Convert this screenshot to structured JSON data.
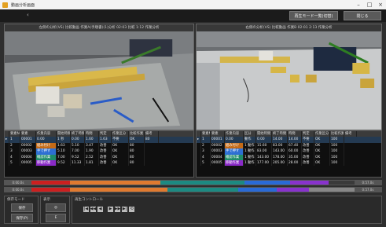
{
  "window": {
    "title": "動画分析画面"
  },
  "toolbar": {
    "left_arrow": "‹",
    "btn_compare": "再生モード一覧(切替)",
    "btn_close": "閉じる"
  },
  "left_video": {
    "caption": "左側の分析(VS) 比較動画 作業A(手順書)(1)分析 02:03 比較 1:12 作業分析"
  },
  "right_video": {
    "caption": "右側の分析(VS) 比較動画 作業B 02:01 2:13 作業分析"
  },
  "left_table": {
    "headers": [
      "",
      "要素No",
      "要素",
      "作業内容",
      "開始時間",
      "終了時間",
      "時間",
      "判定",
      "作業区分",
      "比較作業",
      "備考"
    ],
    "rows": [
      [
        "▸",
        "1",
        "00001",
        "0.00",
        "1 秒",
        "0.00",
        "1.60",
        "1.63",
        "不要",
        "OK",
        "80"
      ],
      [
        "",
        "2",
        "00002",
        "組み付け",
        "1.63",
        "5.10",
        "3.47",
        "改善",
        "OK",
        "80"
      ],
      [
        "",
        "3",
        "00003",
        "手で押す",
        "5.10",
        "7.00",
        "1.90",
        "改善",
        "OK",
        "80"
      ],
      [
        "",
        "4",
        "00004",
        "確認作業",
        "7.00",
        "9.52",
        "2.52",
        "改善",
        "OK",
        "80"
      ],
      [
        "",
        "5",
        "00005",
        "移動作業",
        "9.52",
        "11.33",
        "1.81",
        "改善",
        "OK",
        "80"
      ]
    ],
    "tag_colors": [
      "",
      "#c46a16",
      "#2d6fd3",
      "#1e8c6a",
      "#8a2ac7"
    ]
  },
  "right_table": {
    "headers": [
      "",
      "要素No",
      "要素",
      "作業内容",
      "区分",
      "開始時間",
      "終了時間",
      "時間",
      "判定",
      "作業区分",
      "比較作業",
      "備考"
    ],
    "rows": [
      [
        "▸",
        "1",
        "00001",
        "0.00",
        "動作",
        "0.00",
        "14.00",
        "14.00",
        "不要",
        "OK",
        "100"
      ],
      [
        "",
        "2",
        "00002",
        "組み付け",
        "1 動作",
        "15.60",
        "83.00",
        "67.40",
        "改善",
        "OK",
        "100"
      ],
      [
        "",
        "3",
        "00003",
        "手で押す",
        "1 動作",
        "83.00",
        "143.00",
        "60.00",
        "改善",
        "OK",
        "100"
      ],
      [
        "",
        "4",
        "00004",
        "確認作業",
        "1 動作",
        "143.00",
        "178.00",
        "35.00",
        "改善",
        "OK",
        "100"
      ],
      [
        "",
        "5",
        "00005",
        "移動作業",
        "1 動作",
        "177.00",
        "205.00",
        "28.00",
        "改善",
        "OK",
        "100"
      ]
    ],
    "tag_colors": [
      "",
      "#c46a16",
      "#2d6fd3",
      "#1e8c6a",
      "#8a2ac7"
    ]
  },
  "timeline1": {
    "start": "0:00.0s",
    "end": "0:57.0s",
    "segments": [
      {
        "color": "#cc2020",
        "frac": 0.12
      },
      {
        "color": "#e07a30",
        "frac": 0.28
      },
      {
        "color": "#1d8a82",
        "frac": 0.26
      },
      {
        "color": "#2a6ad6",
        "frac": 0.14
      },
      {
        "color": "#8833cc",
        "frac": 0.12
      },
      {
        "color": "#3a3a3a",
        "frac": 0.08
      }
    ]
  },
  "timeline2": {
    "start": "0:00.0s",
    "end": "0:57.0s",
    "segments": [
      {
        "color": "#cc2020",
        "frac": 0.12
      },
      {
        "color": "#e07a30",
        "frac": 0.3
      },
      {
        "color": "#1d8a82",
        "frac": 0.22
      },
      {
        "color": "#2a6ad6",
        "frac": 0.12
      },
      {
        "color": "#8833cc",
        "frac": 0.1
      },
      {
        "color": "#888888",
        "frac": 0.14
      }
    ]
  },
  "panel_save": {
    "title": "保存モード",
    "btn_top": "保存",
    "btn_bottom": "保存(P)"
  },
  "panel_view": {
    "title": "表示",
    "btn_top": "◎",
    "btn_bottom": "E"
  },
  "panel_play": {
    "title": "再生コントロール",
    "controls": [
      "|◀",
      "◀◀",
      "◀",
      "▶",
      "▶▶",
      "▶|",
      "⟲"
    ]
  }
}
